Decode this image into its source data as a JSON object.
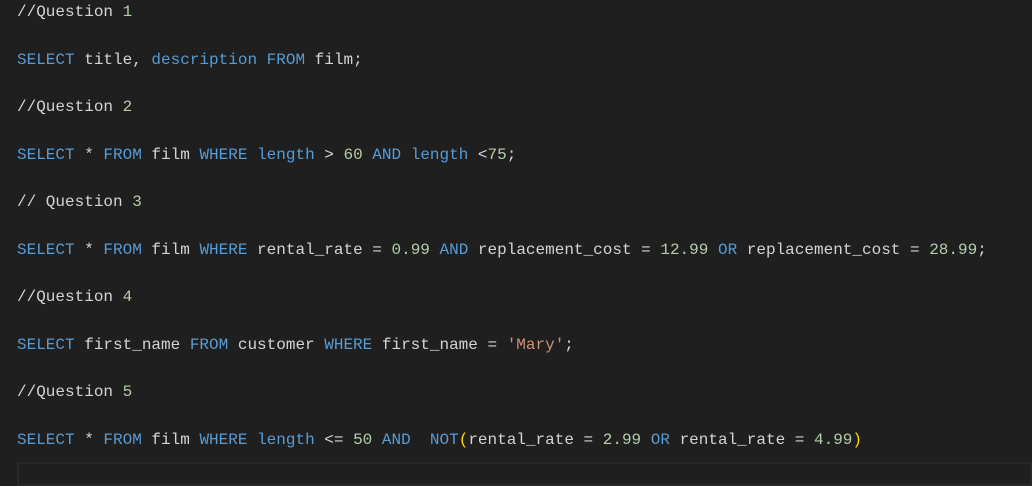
{
  "editor": {
    "colors": {
      "keyword": "#569cd6",
      "identifier": "#d4d4d4",
      "number": "#b5cea8",
      "string": "#ce9178",
      "paren": "#ffd700",
      "background": "#1f1f1f"
    },
    "lines": [
      [
        [
          "//Question ",
          "cm"
        ],
        [
          "1",
          "num"
        ]
      ],
      [
        [
          "SELECT",
          "kw"
        ],
        [
          " title, ",
          "id"
        ],
        [
          "description",
          "kw"
        ],
        [
          " ",
          "id"
        ],
        [
          "FROM",
          "kw"
        ],
        [
          " film;",
          "id"
        ]
      ],
      [
        [
          "//Question ",
          "cm"
        ],
        [
          "2",
          "num"
        ]
      ],
      [
        [
          "SELECT",
          "kw"
        ],
        [
          " * ",
          "id"
        ],
        [
          "FROM",
          "kw"
        ],
        [
          " film ",
          "id"
        ],
        [
          "WHERE",
          "kw"
        ],
        [
          " ",
          "id"
        ],
        [
          "length",
          "kw"
        ],
        [
          " > ",
          "id"
        ],
        [
          "60",
          "num"
        ],
        [
          " ",
          "id"
        ],
        [
          "AND",
          "kw"
        ],
        [
          " ",
          "id"
        ],
        [
          "length",
          "kw"
        ],
        [
          " <",
          "id"
        ],
        [
          "75",
          "num"
        ],
        [
          ";",
          "id"
        ]
      ],
      [
        [
          "// Question ",
          "cm"
        ],
        [
          "3",
          "num"
        ]
      ],
      [
        [
          "SELECT",
          "kw"
        ],
        [
          " * ",
          "id"
        ],
        [
          "FROM",
          "kw"
        ],
        [
          " film ",
          "id"
        ],
        [
          "WHERE",
          "kw"
        ],
        [
          " rental_rate = ",
          "id"
        ],
        [
          "0.99",
          "num"
        ],
        [
          " ",
          "id"
        ],
        [
          "AND",
          "kw"
        ],
        [
          " replacement_cost = ",
          "id"
        ],
        [
          "12.99",
          "num"
        ],
        [
          " ",
          "id"
        ],
        [
          "OR",
          "kw"
        ],
        [
          " replacement_cost = ",
          "id"
        ],
        [
          "28.99",
          "num"
        ],
        [
          ";",
          "id"
        ]
      ],
      [
        [
          "//Question ",
          "cm"
        ],
        [
          "4",
          "num"
        ]
      ],
      [
        [
          "SELECT",
          "kw"
        ],
        [
          " first_name ",
          "id"
        ],
        [
          "FROM",
          "kw"
        ],
        [
          " customer ",
          "id"
        ],
        [
          "WHERE",
          "kw"
        ],
        [
          " first_name = ",
          "id"
        ],
        [
          "'Mary'",
          "str"
        ],
        [
          ";",
          "id"
        ]
      ],
      [
        [
          "//Question ",
          "cm"
        ],
        [
          "5",
          "num"
        ]
      ],
      [
        [
          "SELECT",
          "kw"
        ],
        [
          " * ",
          "id"
        ],
        [
          "FROM",
          "kw"
        ],
        [
          " film ",
          "id"
        ],
        [
          "WHERE",
          "kw"
        ],
        [
          " ",
          "id"
        ],
        [
          "length",
          "kw"
        ],
        [
          " <= ",
          "id"
        ],
        [
          "50",
          "num"
        ],
        [
          " ",
          "id"
        ],
        [
          "AND",
          "kw"
        ],
        [
          "  ",
          "id"
        ],
        [
          "NOT",
          "kw"
        ],
        [
          "(",
          "paren"
        ],
        [
          "rental_rate = ",
          "id"
        ],
        [
          "2.99",
          "num"
        ],
        [
          " ",
          "id"
        ],
        [
          "OR",
          "kw"
        ],
        [
          " rental_rate = ",
          "id"
        ],
        [
          "4.99",
          "num"
        ],
        [
          ")",
          "paren"
        ]
      ]
    ]
  }
}
